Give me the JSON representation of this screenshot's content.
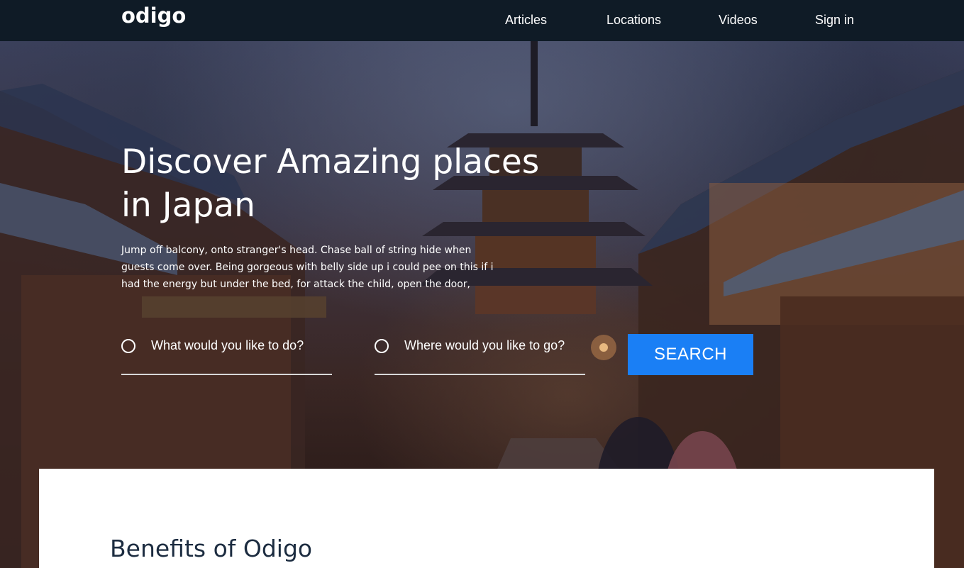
{
  "brand": {
    "logo_text": "odigo"
  },
  "nav": {
    "links": [
      {
        "label": "Articles"
      },
      {
        "label": "Locations"
      },
      {
        "label": "Videos"
      },
      {
        "label": "Sign in"
      }
    ]
  },
  "hero": {
    "title": "Discover Amazing places in Japan",
    "description": "Jump off balcony, onto stranger's head. Chase ball of string hide when guests come over. Being gorgeous with belly side up i could pee on this if i had the energy but under the bed, for attack the child, open the door,",
    "search": {
      "activity_placeholder": "What would you like to do?",
      "location_placeholder": "Where would you like to go?",
      "button_label": "SEARCH"
    }
  },
  "benefits": {
    "title": "Benefits of Odigo"
  },
  "colors": {
    "navbar_bg": "#0f1b26",
    "accent_button": "#1a7ff5",
    "heading_dark": "#1c2c40",
    "text_on_hero": "#ffffff"
  },
  "icons": {
    "field_marker": "radio-circle-icon"
  }
}
